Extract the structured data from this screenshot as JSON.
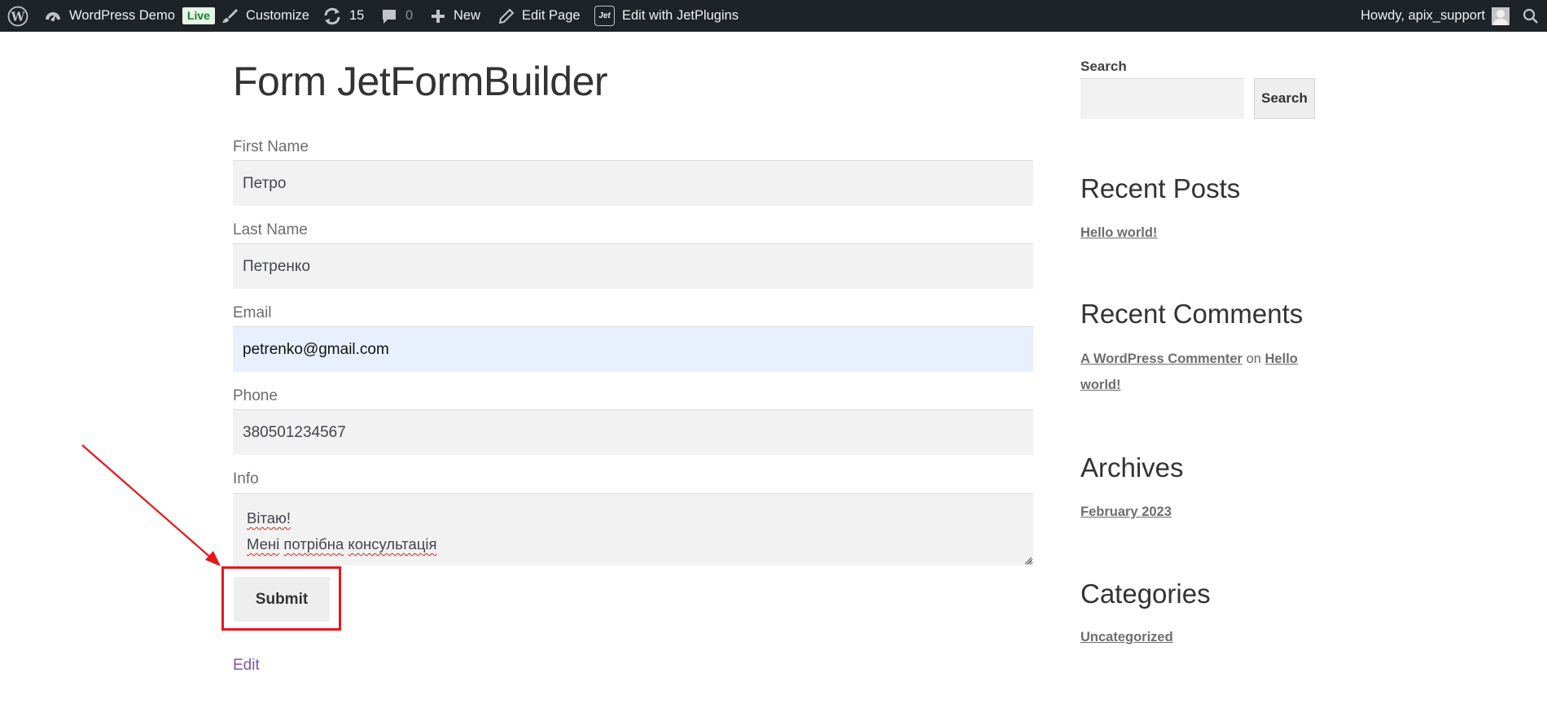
{
  "adminbar": {
    "site_name": "WordPress Demo",
    "live_badge": "Live",
    "customize": "Customize",
    "updates_count": "15",
    "comments_count": "0",
    "new": "New",
    "edit_page": "Edit Page",
    "jet_badge": "Jet",
    "edit_with_jet": "Edit with JetPlugins",
    "howdy": "Howdy, apix_support",
    "bar_color": "#1d2327"
  },
  "page": {
    "title": "Form JetFormBuilder",
    "edit_link": "Edit"
  },
  "form": {
    "first_name": {
      "label": "First Name",
      "value": "Петро"
    },
    "last_name": {
      "label": "Last Name",
      "value": "Петренко"
    },
    "email": {
      "label": "Email",
      "value": "petrenko@gmail.com"
    },
    "phone": {
      "label": "Phone",
      "value": "380501234567"
    },
    "info": {
      "label": "Info",
      "line1": "Вітаю!",
      "line2_word1": "Мені",
      "line2_word2": "потрібна",
      "line2_word3": "консультація"
    },
    "submit_label": "Submit"
  },
  "sidebar": {
    "search_title": "Search",
    "search_button": "Search",
    "recent_posts_title": "Recent Posts",
    "recent_posts": [
      "Hello world!"
    ],
    "recent_comments_title": "Recent Comments",
    "comment_author": "A WordPress Commenter",
    "comment_on": "on",
    "comment_post": "Hello world!",
    "archives_title": "Archives",
    "archives": [
      "February 2023"
    ],
    "categories_title": "Categories",
    "categories": [
      "Uncategorized"
    ]
  },
  "annotation": {
    "color": "#e8161b"
  }
}
